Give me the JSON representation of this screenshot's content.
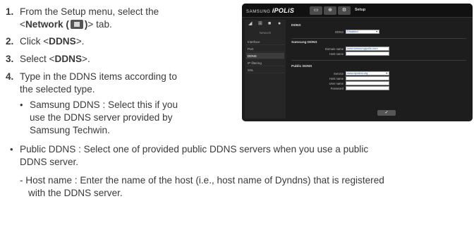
{
  "steps": [
    {
      "num": "1.",
      "text_before": "From the Setup menu, select the",
      "line2_prefix": "<",
      "line2_bold": "Network (",
      "line2_bold_end": ")",
      "line2_suffix": "> tab."
    },
    {
      "num": "2.",
      "text_before": "Click <",
      "bold": "DDNS",
      "text_after": ">."
    },
    {
      "num": "3.",
      "text_before": "Select <",
      "bold": "DDNS",
      "text_after": ">."
    },
    {
      "num": "4.",
      "line1": "Type in the DDNS items according to",
      "line2": "the selected type."
    }
  ],
  "bullets": [
    {
      "lines": [
        "Samsung DDNS : Select this if you",
        "use the DDNS server provided by",
        "Samsung Techwin."
      ]
    },
    {
      "lines": [
        "Public DDNS : Select one of provided public DDNS servers when you use a public",
        "DDNS server."
      ]
    }
  ],
  "dash_item": {
    "lines": [
      "- Host name : Enter the name of the host (i.e., host name of Dyndns) that is registered",
      "with the DDNS server."
    ]
  },
  "screenshot": {
    "logo_brand": "SAMSUNG",
    "logo_product": "iPOLiS",
    "top_buttons": [
      "▭",
      "⊕",
      "⚙"
    ],
    "page_label": "Setup",
    "sidebar_icons": [
      "◢",
      "⊞",
      "■",
      "●"
    ],
    "sidebar_title": "Network",
    "sidebar_items": [
      "Interface",
      "Port",
      "DDNS",
      "IP filtering",
      "SSL"
    ],
    "active_item_index": 2,
    "sections": {
      "ddns": {
        "title": "DDNS",
        "label": "DDNS",
        "value": "Disabled"
      },
      "samsung": {
        "title": "Samsung DDNS",
        "fields": [
          {
            "label": "Domain name",
            "value": "www.samsungipolis.com"
          },
          {
            "label": "Host name",
            "value": ""
          }
        ]
      },
      "public": {
        "title": "Public DDNS",
        "fields": [
          {
            "label": "Service",
            "value": "www.dyndns.org"
          },
          {
            "label": "Host name",
            "value": ""
          },
          {
            "label": "User name",
            "value": ""
          },
          {
            "label": "Password",
            "value": ""
          }
        ]
      }
    },
    "apply_label": "✓"
  }
}
